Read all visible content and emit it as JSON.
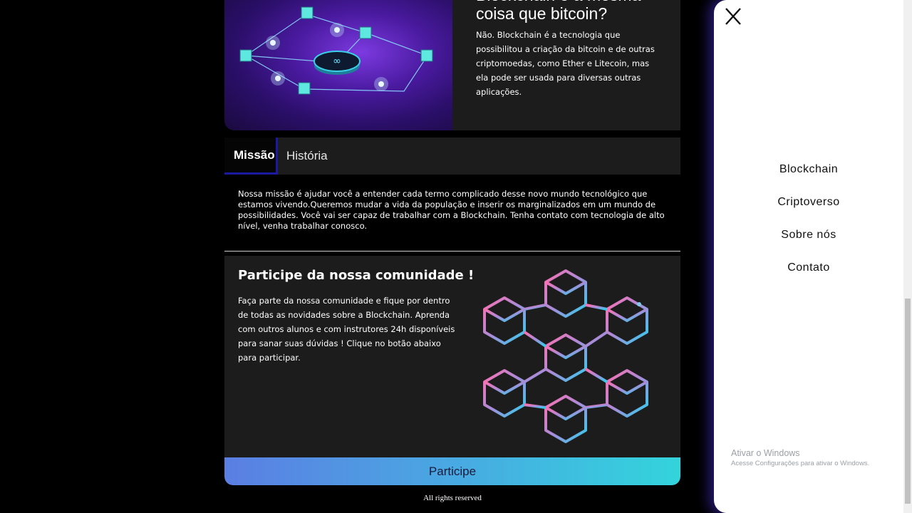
{
  "faq": {
    "question": "Blockchain é a mesma coisa que bitcoin?",
    "answer": "Não. Blockchain é a tecnologia que possibilitou a criação da bitcoin e de outras criptomoedas, como Ether e Litecoin, mas ela pode ser usada para diversas outras aplicações."
  },
  "tabs": [
    {
      "label": "Missão",
      "active": true
    },
    {
      "label": "História",
      "active": false
    }
  ],
  "mission_text": "Nossa missão é ajudar você a entender cada termo complicado desse novo mundo tecnológico que estamos vivendo.Queremos mudar a vida da população e inserir os marginalizados em um mundo de possibilidades. Você vai ser capaz de trabalhar com a Blockchain. Tenha contato com tecnologia de alto nível, venha trabalhar conosco.",
  "community": {
    "title": "Participe da nossa comunidade !",
    "description": "Faça parte da nossa comunidade e fique por dentro de todas as novidades sobre a Blockchain. Aprenda com outros alunos e com instrutores 24h disponíveis para sanar suas dúvidas ! Clique no botão abaixo para participar.",
    "button_label": "Participe"
  },
  "footer": "All rights reserved",
  "menu": {
    "items": [
      "Blockchain",
      "Criptoverso",
      "Sobre nós",
      "Contato"
    ],
    "close_icon": "close-icon"
  },
  "watermark": {
    "title": "Ativar o Windows",
    "subtitle": "Acesse Configurações para ativar o Windows."
  },
  "colors": {
    "accent_blue": "#1a1aa0",
    "button_gradient_start": "#5b7ee3",
    "button_gradient_end": "#33d4dc"
  }
}
